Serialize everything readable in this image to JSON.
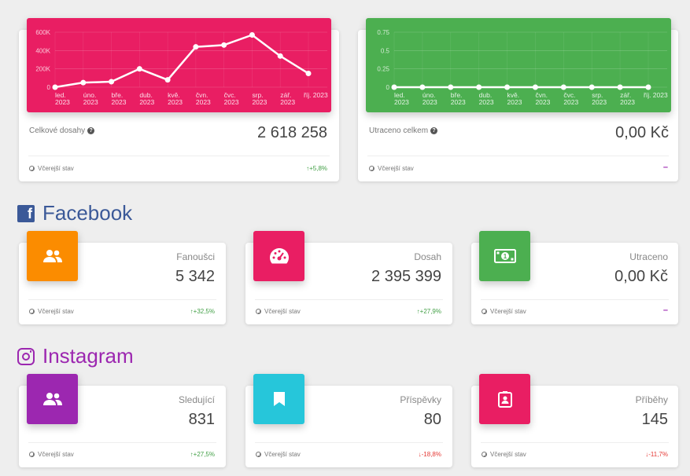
{
  "colors": {
    "pink": "#e91e63",
    "green": "#4caf50",
    "orange": "#fb8c00",
    "purple": "#9c27b0",
    "cyan": "#26c6da",
    "facebook": "#3b5998"
  },
  "overview": {
    "reach": {
      "label": "Celkové dosahy",
      "value": "2 618 258",
      "footer": "Včerejší stav",
      "trend": "+5,8%"
    },
    "spent": {
      "label": "Utraceno celkem",
      "value": "0,00 Kč",
      "footer": "Včerejší stav",
      "trend": "–"
    }
  },
  "facebook": {
    "title": "Facebook",
    "cards": [
      {
        "icon": "people-icon",
        "label": "Fanoušci",
        "value": "5 342",
        "footer": "Včerejší stav",
        "trend": "+32,5%"
      },
      {
        "icon": "speedometer-icon",
        "label": "Dosah",
        "value": "2 395 399",
        "footer": "Včerejší stav",
        "trend": "+27,9%"
      },
      {
        "icon": "money-icon",
        "label": "Utraceno",
        "value": "0,00 Kč",
        "footer": "Včerejší stav",
        "trend": "–"
      }
    ]
  },
  "instagram": {
    "title": "Instagram",
    "cards": [
      {
        "icon": "people-icon",
        "label": "Sledující",
        "value": "831",
        "footer": "Včerejší stav",
        "trend": "+27,5%"
      },
      {
        "icon": "bookmark-icon",
        "label": "Příspěvky",
        "value": "80",
        "footer": "Včerejší stav",
        "trend": "-18,8%"
      },
      {
        "icon": "portrait-badge-icon",
        "label": "Příběhy",
        "value": "145",
        "footer": "Včerejší stav",
        "trend": "-11,7%"
      }
    ]
  },
  "chart_data": [
    {
      "type": "line",
      "categories": [
        [
          "led.",
          "2023"
        ],
        [
          "úno.",
          "2023"
        ],
        [
          "bře.",
          "2023"
        ],
        [
          "dub.",
          "2023"
        ],
        [
          "kvě.",
          "2023"
        ],
        [
          "čvn.",
          "2023"
        ],
        [
          "čvc.",
          "2023"
        ],
        [
          "srp.",
          "2023"
        ],
        [
          "zář.",
          "2023"
        ],
        [
          "říj. 2023",
          ""
        ]
      ],
      "values": [
        0,
        50000,
        60000,
        200000,
        80000,
        440000,
        460000,
        570000,
        340000,
        150000
      ],
      "yticks": [
        "600K",
        "400K",
        "200K",
        "0"
      ],
      "ylim": [
        0,
        600000
      ],
      "grid": true,
      "background": "#e91e63",
      "line_color": "#ffffff"
    },
    {
      "type": "line",
      "categories": [
        [
          "led.",
          "2023"
        ],
        [
          "úno.",
          "2023"
        ],
        [
          "bře.",
          "2023"
        ],
        [
          "dub.",
          "2023"
        ],
        [
          "kvě.",
          "2023"
        ],
        [
          "čvn.",
          "2023"
        ],
        [
          "čvc.",
          "2023"
        ],
        [
          "srp.",
          "2023"
        ],
        [
          "zář.",
          "2023"
        ],
        [
          "říj. 2023",
          ""
        ]
      ],
      "values": [
        0,
        0,
        0,
        0,
        0,
        0,
        0,
        0,
        0,
        0
      ],
      "yticks": [
        "0.75",
        "0.5",
        "0.25",
        "0"
      ],
      "ylim": [
        0,
        1
      ],
      "grid": true,
      "background": "#4caf50",
      "line_color": "#ffffff"
    }
  ]
}
